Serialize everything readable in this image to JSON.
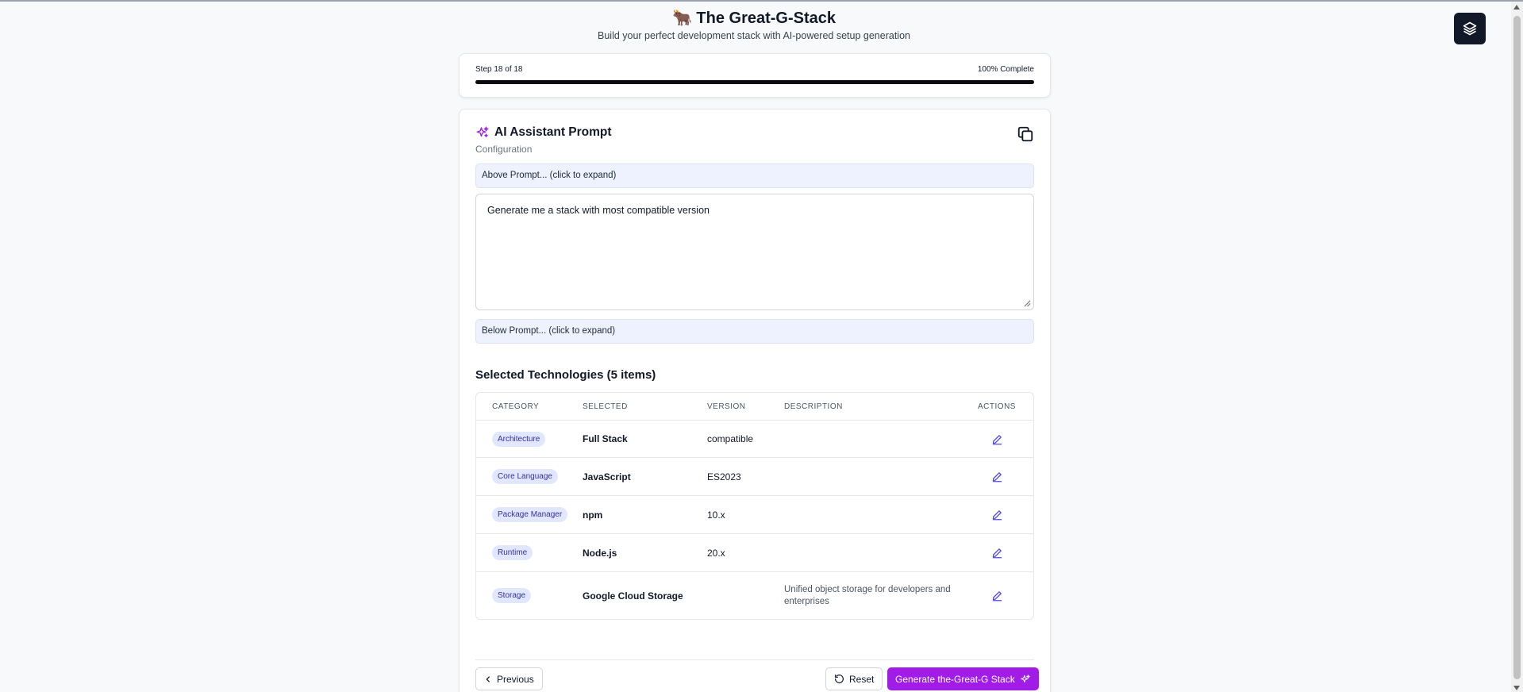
{
  "header": {
    "title": "🐂 The Great-G-Stack",
    "subtitle": "Build your perfect development stack with AI-powered setup generation"
  },
  "progress": {
    "step_label": "Step 18 of 18",
    "complete_label": "100% Complete",
    "fraction": 1.0
  },
  "prompt_card": {
    "title": "AI Assistant Prompt",
    "subtitle": "Configuration",
    "above_prompt": "Above Prompt... (click to expand)",
    "prompt_text": "Generate me a stack with most compatible version",
    "below_prompt": "Below Prompt... (click to expand)"
  },
  "technologies": {
    "title": "Selected Technologies (5 items)",
    "columns": [
      "Category",
      "Selected",
      "Version",
      "Description",
      "Actions"
    ],
    "rows": [
      {
        "category": "Architecture",
        "selected": "Full Stack",
        "version": "compatible",
        "description": ""
      },
      {
        "category": "Core Language",
        "selected": "JavaScript",
        "version": "ES2023",
        "description": ""
      },
      {
        "category": "Package Manager",
        "selected": "npm",
        "version": "10.x",
        "description": ""
      },
      {
        "category": "Runtime",
        "selected": "Node.js",
        "version": "20.x",
        "description": ""
      },
      {
        "category": "Storage",
        "selected": "Google Cloud Storage",
        "version": "",
        "description": "Unified object storage for developers and enterprises"
      }
    ]
  },
  "footer": {
    "previous_label": "Previous",
    "reset_label": "Reset",
    "generate_label": "Generate the-Great-G Stack"
  },
  "colors": {
    "accent": "#a21ce8",
    "badge_bg": "#e0e7ff",
    "badge_text": "#3730a3",
    "edit_icon": "#4f46e5"
  }
}
